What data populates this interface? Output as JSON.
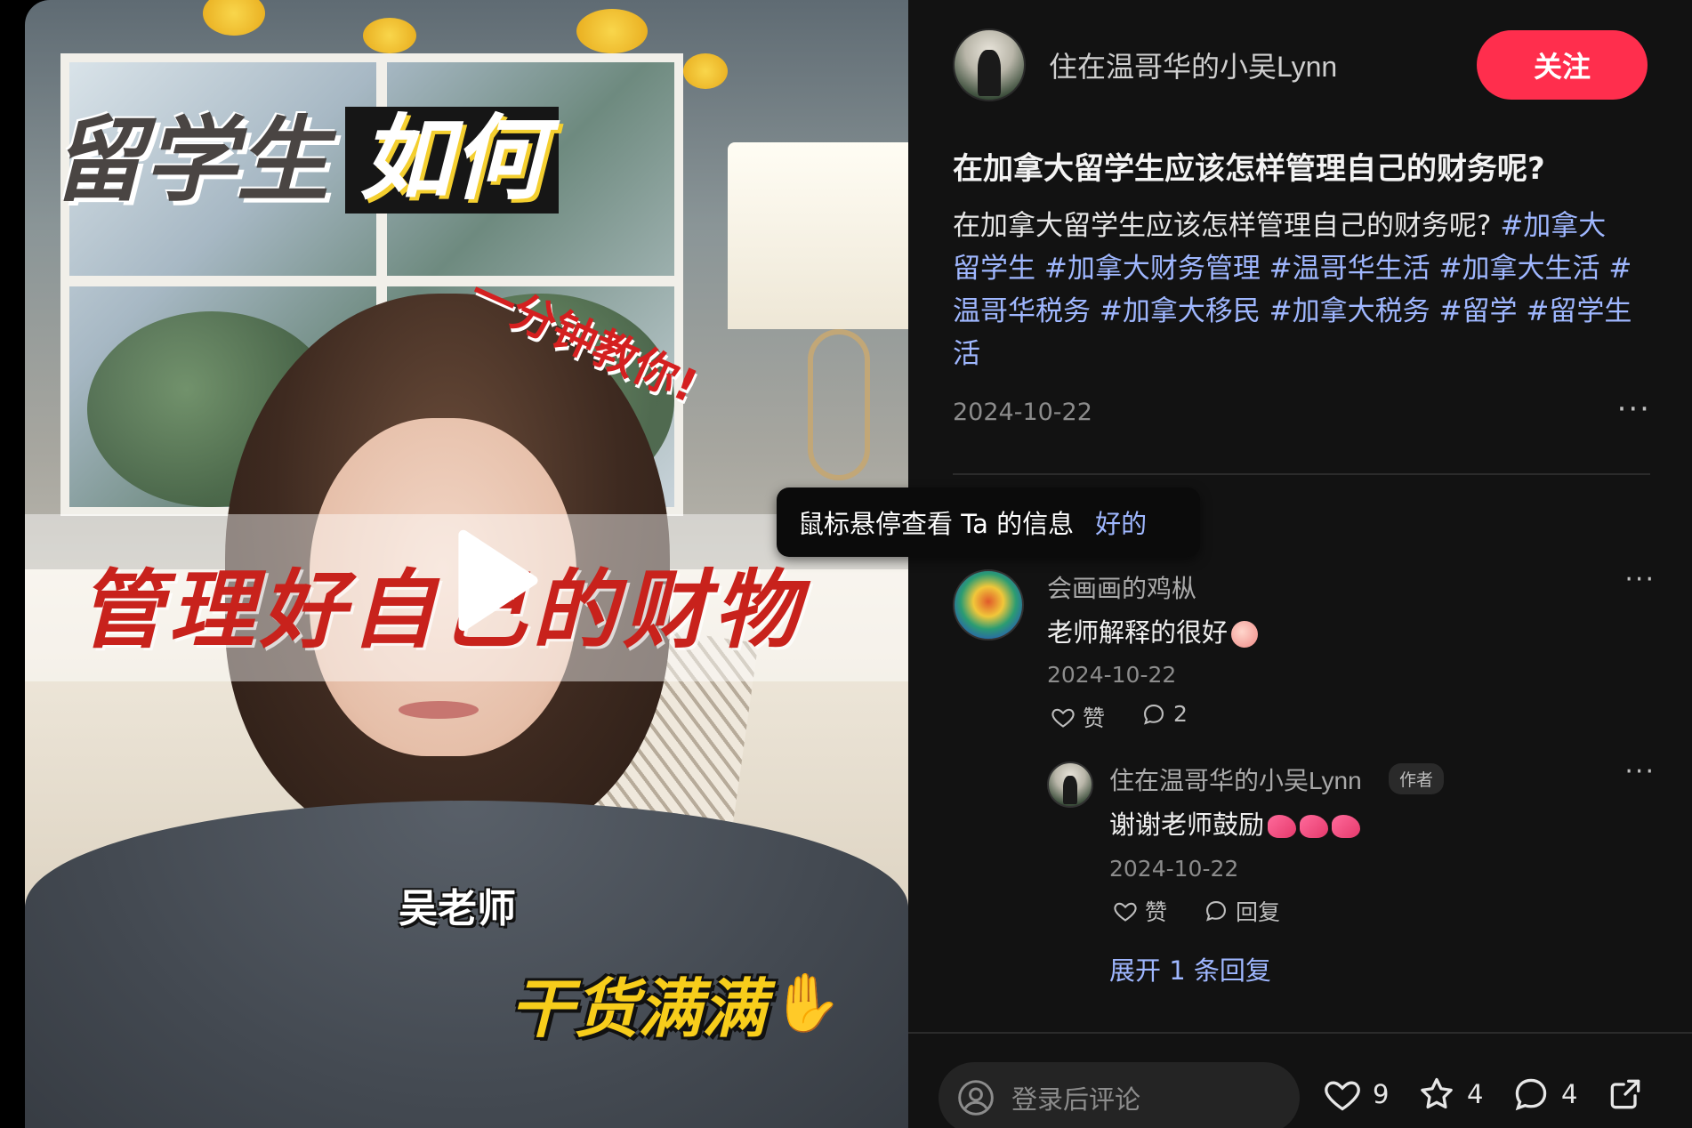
{
  "video": {
    "caption_title_part1": "留学生",
    "caption_title_part2": "如何",
    "caption_subtitle": "一分钟教你!",
    "caption_main": "管理好自己的财物",
    "caption_name": "吴老师",
    "caption_goods": "干货满满",
    "play_icon": "play-icon"
  },
  "author": {
    "name": "住在温哥华的小吴Lynn",
    "follow_label": "关注"
  },
  "post": {
    "title": "在加拿大留学生应该怎样管理自己的财务呢?",
    "body_lines": [
      [
        {
          "text": "在加拿大留学生应该怎样管理自己的财务呢? ",
          "tag": false
        },
        {
          "text": "#加拿大",
          "tag": true
        }
      ],
      [
        {
          "text": "留学生",
          "tag": true
        },
        {
          "text": " #加拿大财务管理",
          "tag": true
        },
        {
          "text": " #温哥华生活",
          "tag": true
        },
        {
          "text": " #加拿大生活",
          "tag": true
        },
        {
          "text": " #",
          "tag": true
        }
      ],
      [
        {
          "text": "温哥华税务",
          "tag": true
        },
        {
          "text": " #加拿大移民",
          "tag": true
        },
        {
          "text": " #加拿大税务",
          "tag": true
        },
        {
          "text": " #留学",
          "tag": true
        },
        {
          "text": " #留学生",
          "tag": true
        }
      ],
      [
        {
          "text": "活",
          "tag": true
        }
      ]
    ],
    "date": "2024-10-22",
    "more_label": "···"
  },
  "tooltip": {
    "text": "鼠标悬停查看 Ta 的信息",
    "ok_label": "好的"
  },
  "comments": [
    {
      "user": "会画画的鸡枞",
      "text": "老师解释的很好",
      "date": "2024-10-22",
      "like_label": "赞",
      "reply_count": "2",
      "more_label": "···"
    }
  ],
  "reply": {
    "user": "住在温哥华的小吴Lynn",
    "badge": "作者",
    "text": "谢谢老师鼓励",
    "date": "2024-10-22",
    "like_label": "赞",
    "reply_label": "回复",
    "more_label": "···"
  },
  "expand_replies": "展开 1 条回复",
  "bottom_bar": {
    "comment_placeholder": "登录后评论",
    "likes": "9",
    "collects": "4",
    "comments": "4"
  },
  "colors": {
    "follow_button": "#ff2e4d",
    "tag_link": "#9fb7ff",
    "pane_background": "#121212"
  }
}
